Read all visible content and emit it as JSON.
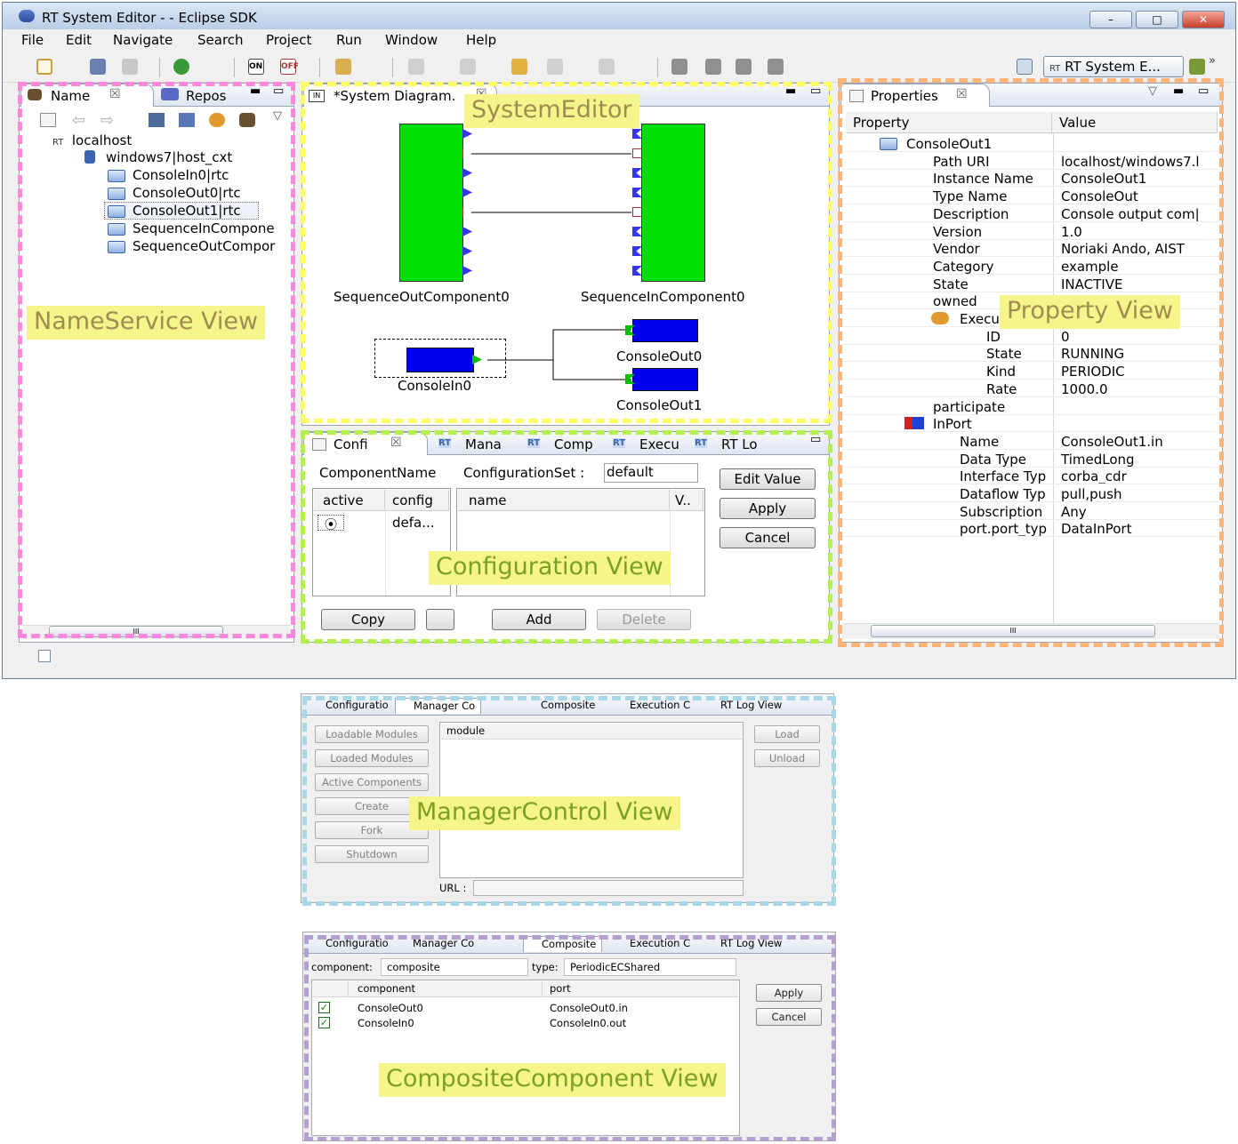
{
  "window": {
    "title": "RT System Editor -  - Eclipse SDK",
    "min": "–",
    "max": "□",
    "close": "✕"
  },
  "menu": [
    "File",
    "Edit",
    "Navigate",
    "Search",
    "Project",
    "Run",
    "Window",
    "Help"
  ],
  "toolbar": {
    "perspective_label": "RT System E...",
    "perspective_prefix": "RT",
    "more": "»"
  },
  "nameservice": {
    "tabs": [
      {
        "label": "Name"
      },
      {
        "label": "Repos"
      }
    ],
    "tree": [
      {
        "label": "localhost",
        "prefix": "RT"
      },
      {
        "label": "windows7|host_cxt"
      },
      {
        "label": "ConsoleIn0|rtc"
      },
      {
        "label": "ConsoleOut0|rtc"
      },
      {
        "label": "ConsoleOut1|rtc"
      },
      {
        "label": "SequenceInCompone"
      },
      {
        "label": "SequenceOutCompor"
      }
    ],
    "overlay": "NameService View",
    "scroll": "III"
  },
  "editor": {
    "tab": "*System Diagram.",
    "overlay": "SystemEditor",
    "components": {
      "seq_out": "SequenceOutComponent0",
      "seq_in": "SequenceInComponent0",
      "console_in": "ConsoleIn0",
      "console_out0": "ConsoleOut0",
      "console_out1": "ConsoleOut1"
    },
    "colors": {
      "green": "#00e000",
      "blue": "#0000ee"
    }
  },
  "config": {
    "tabs": [
      "Confi",
      "Mana",
      "Comp",
      "Execu",
      "RT Lo"
    ],
    "component_name_label": "ComponentName",
    "configset_label": "ConfigurationSet :",
    "configset_value": "default",
    "left_cols": [
      "active",
      "config"
    ],
    "left_row": {
      "active": "⦿",
      "config": "defa..."
    },
    "right_cols": [
      "name",
      "V.."
    ],
    "buttons": {
      "edit": "Edit Value",
      "apply": "Apply",
      "cancel": "Cancel",
      "copy": "Copy",
      "add": "Add",
      "delete": "Delete"
    },
    "overlay": "Configuration View"
  },
  "properties": {
    "tab": "Properties",
    "cols": [
      "Property",
      "Value"
    ],
    "rows": [
      {
        "name": "ConsoleOut1",
        "value": ""
      },
      {
        "name": "Path URI",
        "value": "localhost/windows7.l"
      },
      {
        "name": "Instance Name",
        "value": "ConsoleOut1"
      },
      {
        "name": "Type Name",
        "value": "ConsoleOut"
      },
      {
        "name": "Description",
        "value": "Console output com|"
      },
      {
        "name": "Version",
        "value": "1.0"
      },
      {
        "name": "Vendor",
        "value": "Noriaki Ando, AIST"
      },
      {
        "name": "Category",
        "value": "example"
      },
      {
        "name": "State",
        "value": "INACTIVE"
      },
      {
        "name": "owned",
        "value": ""
      },
      {
        "name": "Execu",
        "value": ""
      },
      {
        "name": "ID",
        "value": "0"
      },
      {
        "name": "State",
        "value": "RUNNING"
      },
      {
        "name": "Kind",
        "value": "PERIODIC"
      },
      {
        "name": "Rate",
        "value": "1000.0"
      },
      {
        "name": "participate",
        "value": ""
      },
      {
        "name": "InPort",
        "value": ""
      },
      {
        "name": "Name",
        "value": "ConsoleOut1.in"
      },
      {
        "name": "Data Type",
        "value": "TimedLong"
      },
      {
        "name": "Interface Typ",
        "value": "corba_cdr"
      },
      {
        "name": "Dataflow Typ",
        "value": "pull,push"
      },
      {
        "name": "Subscription",
        "value": "Any"
      },
      {
        "name": "port.port_typ",
        "value": "DataInPort"
      }
    ],
    "overlay": "Property View",
    "scroll": "III"
  },
  "manager": {
    "tabs": [
      "Configuratio",
      "Manager Co",
      "Composite",
      "Execution C",
      "RT Log View"
    ],
    "left_buttons": [
      "Loadable Modules",
      "Loaded Modules",
      "Active Components",
      "Create",
      "Fork",
      "Shutdown"
    ],
    "list_header": "module",
    "url_label": "URL :",
    "right_buttons": [
      "Load",
      "Unload"
    ],
    "overlay": "ManagerControl  View"
  },
  "composite": {
    "tabs": [
      "Configuratio",
      "Manager Co",
      "Composite",
      "Execution C",
      "RT Log View"
    ],
    "component_label": "component:",
    "component_value": "composite",
    "type_label": "type:",
    "type_value": "PeriodicECShared",
    "cols": [
      "component",
      "port"
    ],
    "rows": [
      {
        "component": "ConsoleOut0",
        "port": "ConsoleOut0.in"
      },
      {
        "component": "ConsoleIn0",
        "port": "ConsoleIn0.out"
      }
    ],
    "check": "✓",
    "buttons": {
      "apply": "Apply",
      "cancel": "Cancel"
    },
    "overlay": "CompositeComponent View"
  },
  "overlay_colors": {
    "nameservice": "#ff88dd",
    "editor": "#ffff66",
    "config": "#b4f050",
    "property": "#ffb47a",
    "manager": "#a8d8e8",
    "composite": "#b4a0d0",
    "label_bg": "#f5f58c",
    "label_text": "#a08c50",
    "label_text_config": "#7ca020"
  }
}
